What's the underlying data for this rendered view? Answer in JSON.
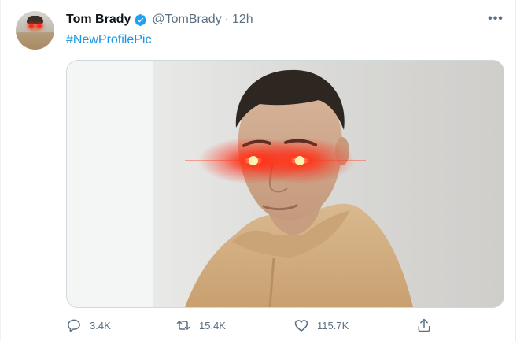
{
  "tweet": {
    "author_name": "Tom Brady",
    "handle": "@TomBrady",
    "separator": "·",
    "time": "12h",
    "text": "#NewProfilePic",
    "more_glyph": "•••"
  },
  "actions": {
    "replies": "3.4K",
    "retweets": "15.4K",
    "likes": "115.7K"
  },
  "icons": [
    "verified-badge-icon",
    "more-icon",
    "reply-icon",
    "retweet-icon",
    "like-icon",
    "share-icon"
  ],
  "colors": {
    "link": "#1b95e0",
    "muted": "#5b7083",
    "text": "#0f1419",
    "verified": "#1da1f2",
    "laser": "#ff2a1a"
  }
}
